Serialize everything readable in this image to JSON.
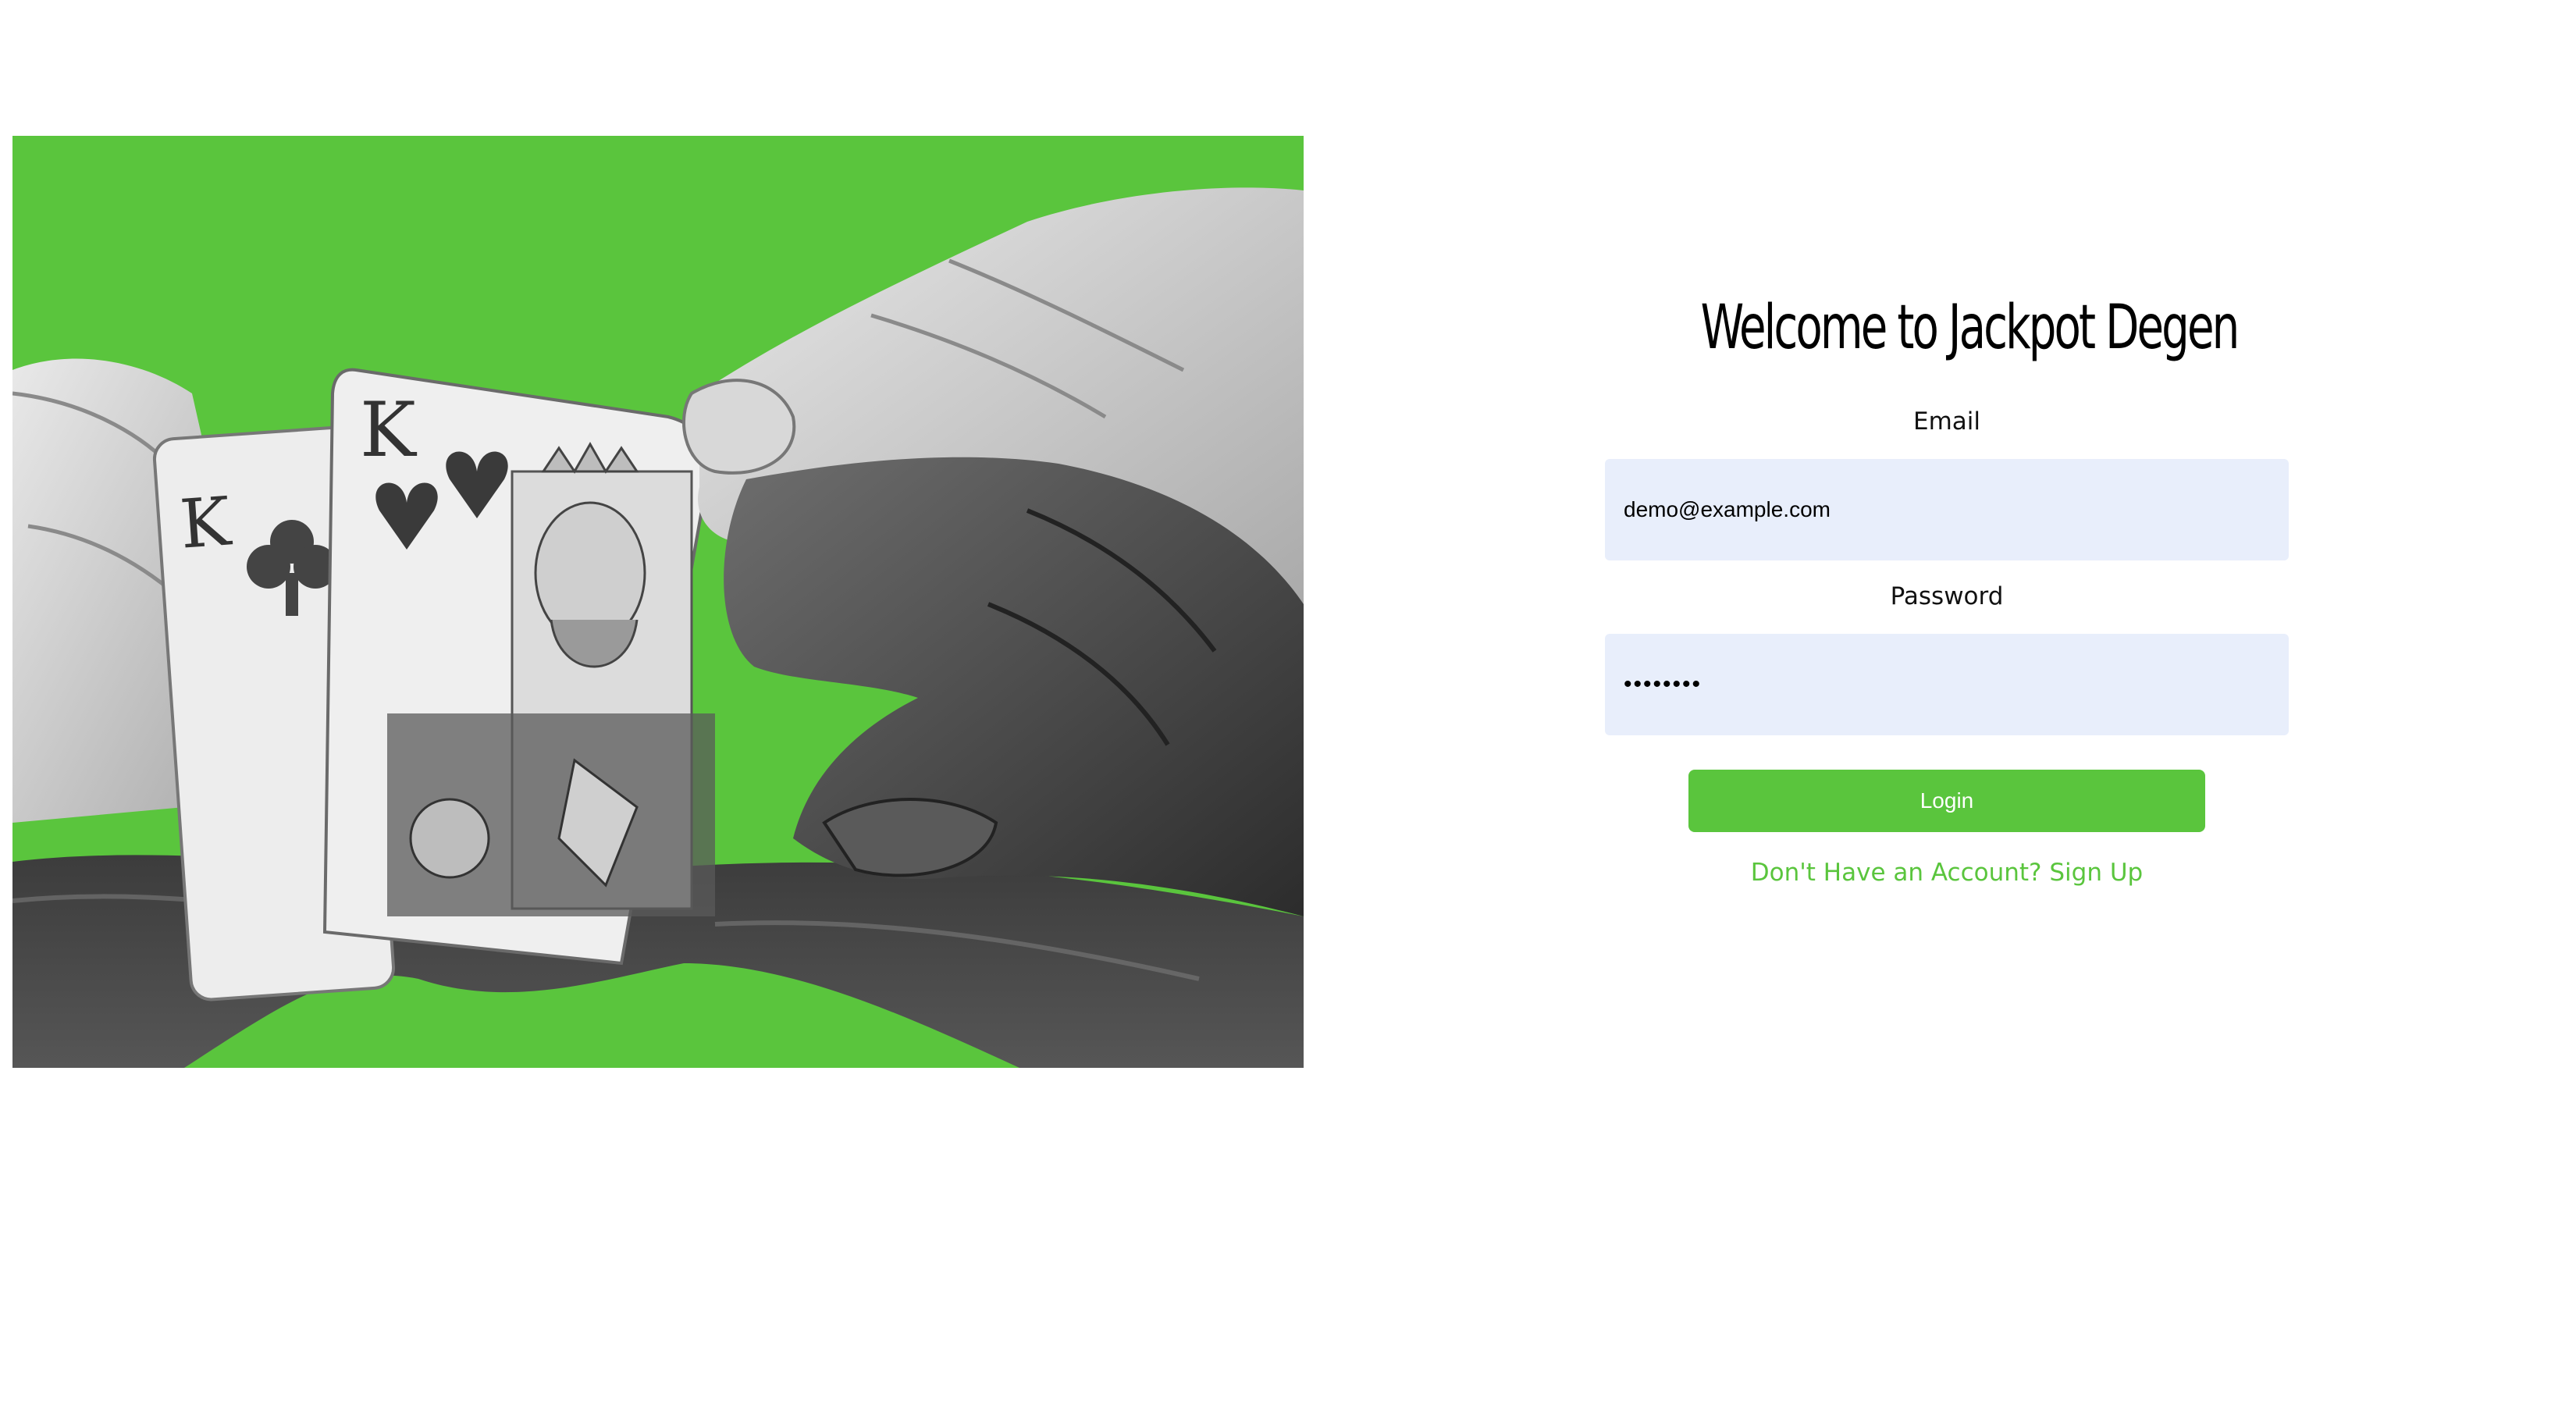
{
  "hero": {
    "card_rank_left": "K",
    "card_rank_right": "K",
    "image_colors": {
      "background": "#5ac53d"
    }
  },
  "login": {
    "title": "Welcome to Jackpot Degen",
    "email_label": "Email",
    "email_value": "demo@example.com",
    "password_label": "Password",
    "password_value": "••••••••",
    "login_button": "Login",
    "signup_link": "Don't Have an Account? Sign Up"
  },
  "colors": {
    "accent": "#5ac53d",
    "input_background": "#e8eefb",
    "text": "#000000"
  }
}
